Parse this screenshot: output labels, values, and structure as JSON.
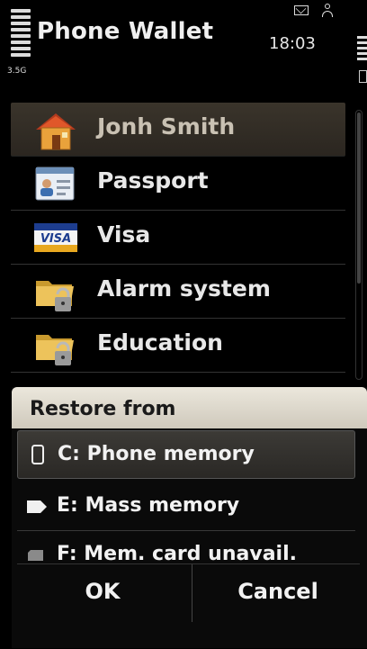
{
  "status_bar": {
    "app_title": "Phone Wallet",
    "time": "18:03",
    "network": "3.5G"
  },
  "wallet_list": [
    {
      "label": "Jonh Smith",
      "icon": "house-icon"
    },
    {
      "label": "Passport",
      "icon": "id-card-icon"
    },
    {
      "label": "Visa",
      "icon": "visa-card-icon"
    },
    {
      "label": "Alarm system",
      "icon": "locked-folder-icon"
    },
    {
      "label": "Education",
      "icon": "locked-folder-icon"
    }
  ],
  "restore_dialog": {
    "title": "Restore from",
    "options": [
      {
        "label": "C: Phone memory",
        "icon": "phone-icon"
      },
      {
        "label": "E: Mass memory",
        "icon": "mass-memory-icon"
      },
      {
        "label": "F: Mem. card unavail.",
        "icon": "memory-card-icon"
      }
    ],
    "ok_label": "OK",
    "cancel_label": "Cancel"
  },
  "colors": {
    "background": "#000000",
    "selected_row": "#3a342b",
    "dialog_header": "#e0dbcf"
  }
}
